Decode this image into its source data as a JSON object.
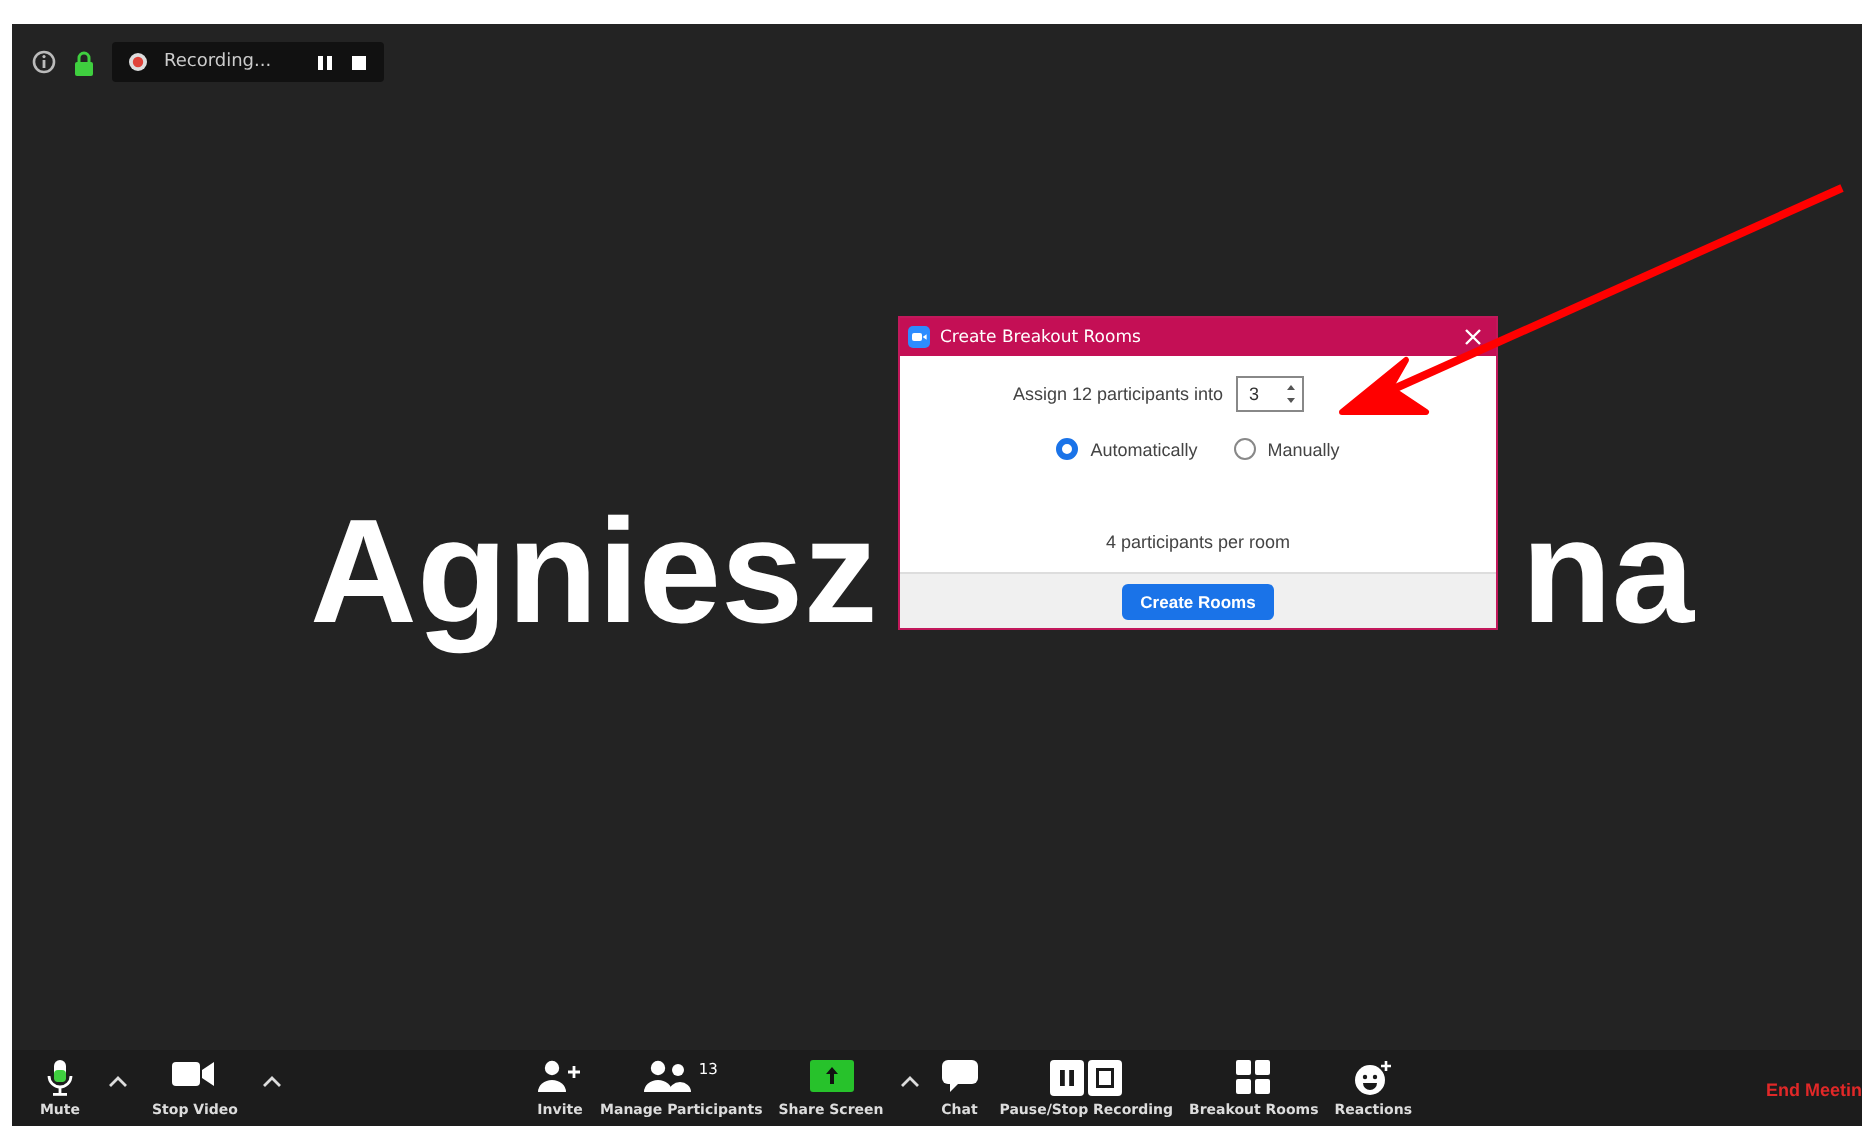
{
  "top_bar": {
    "recording_label": "Recording..."
  },
  "participant_name": {
    "left": "Agniesz",
    "right": "na"
  },
  "dialog": {
    "title": "Create Breakout Rooms",
    "assign_label": "Assign 12 participants into",
    "room_count": "3",
    "options": [
      {
        "label": "Automatically",
        "selected": true
      },
      {
        "label": "Manually",
        "selected": false
      }
    ],
    "per_room": "4 participants per room",
    "create_button": "Create Rooms"
  },
  "toolbar": {
    "left": [
      {
        "kind": "mic",
        "label": "Mute",
        "caret": true
      },
      {
        "kind": "video",
        "label": "Stop Video",
        "caret": true
      }
    ],
    "center": [
      {
        "kind": "invite",
        "label": "Invite",
        "caret": false
      },
      {
        "kind": "participants",
        "label": "Manage Participants",
        "count": "13",
        "caret": false
      },
      {
        "kind": "share",
        "label": "Share Screen",
        "caret": true
      },
      {
        "kind": "chat",
        "label": "Chat",
        "caret": false
      },
      {
        "kind": "recording",
        "label": "Pause/Stop Recording",
        "caret": false
      },
      {
        "kind": "breakout",
        "label": "Breakout Rooms",
        "caret": false
      },
      {
        "kind": "reactions",
        "label": "Reactions",
        "caret": false
      }
    ],
    "end_button": "End Meetin"
  }
}
